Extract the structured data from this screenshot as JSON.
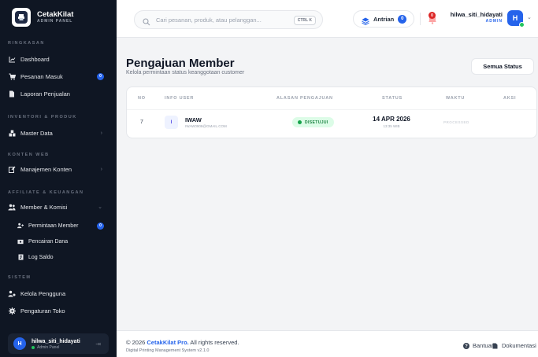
{
  "brand": {
    "name": "CetakKilat",
    "subtitle": "ADMIN PANEL"
  },
  "sidebar": {
    "sections": [
      {
        "label": "RINGKASAN"
      },
      {
        "label": "INVENTORI & PRODUK"
      },
      {
        "label": "KONTEN WEB"
      },
      {
        "label": "AFFILIATE & KEUANGAN"
      },
      {
        "label": "SISTEM"
      }
    ],
    "items": {
      "dashboard": "Dashboard",
      "pesanan_masuk": "Pesanan Masuk",
      "pesanan_badge": "0",
      "laporan": "Laporan Penjualan",
      "master_data": "Master Data",
      "manajemen_konten": "Manajemen Konten",
      "member_komisi": "Member & Komisi",
      "permintaan_member": "Permintaan Member",
      "permintaan_badge": "0",
      "pencairan_dana": "Pencairan Dana",
      "log_saldo": "Log Saldo",
      "kelola_pengguna": "Kelola Pengguna",
      "pengaturan_toko": "Pengaturan Toko"
    },
    "user": {
      "initial": "H",
      "name": "hilwa_siti_hidayati",
      "role": "Admin Panel"
    }
  },
  "header": {
    "search_placeholder": "Cari pesanan, produk, atau pelanggan...",
    "search_shortcut": "CTRL K",
    "antrian_label": "Antrian",
    "antrian_count": "0",
    "notif_count": "0",
    "user_name": "hilwa_siti_hidayati",
    "user_role": "ADMIN",
    "user_initial": "H"
  },
  "main": {
    "title": "Pengajuan Member",
    "subtitle": "Kelola permintaan status keanggotaan customer",
    "status_filter": "Semua Status",
    "columns": [
      "NO",
      "INFO USER",
      "ALASAN PENGAJUAN",
      "STATUS",
      "WAKTU",
      "AKSI"
    ],
    "rows": [
      {
        "no": "7",
        "initial": "I",
        "name": "IWAW",
        "email": "IWAW0908@GMAIL.COM",
        "status": "DISETUJUI",
        "date": "14 APR 2026",
        "time": "13:35 WIB",
        "action": "PROCESSED"
      }
    ]
  },
  "footer": {
    "copyright_prefix": "© 2026",
    "copyright_brand": "CetakKilat Pro.",
    "copyright_suffix": "All rights reserved.",
    "version": "Digital Printing Management System v2.1.0",
    "help": "Bantuan",
    "docs": "Dokumentasi"
  },
  "colors": {
    "accent": "#2563eb",
    "sidebar_bg": "#0f1623",
    "success": "#16a34a",
    "danger": "#dc2626"
  }
}
